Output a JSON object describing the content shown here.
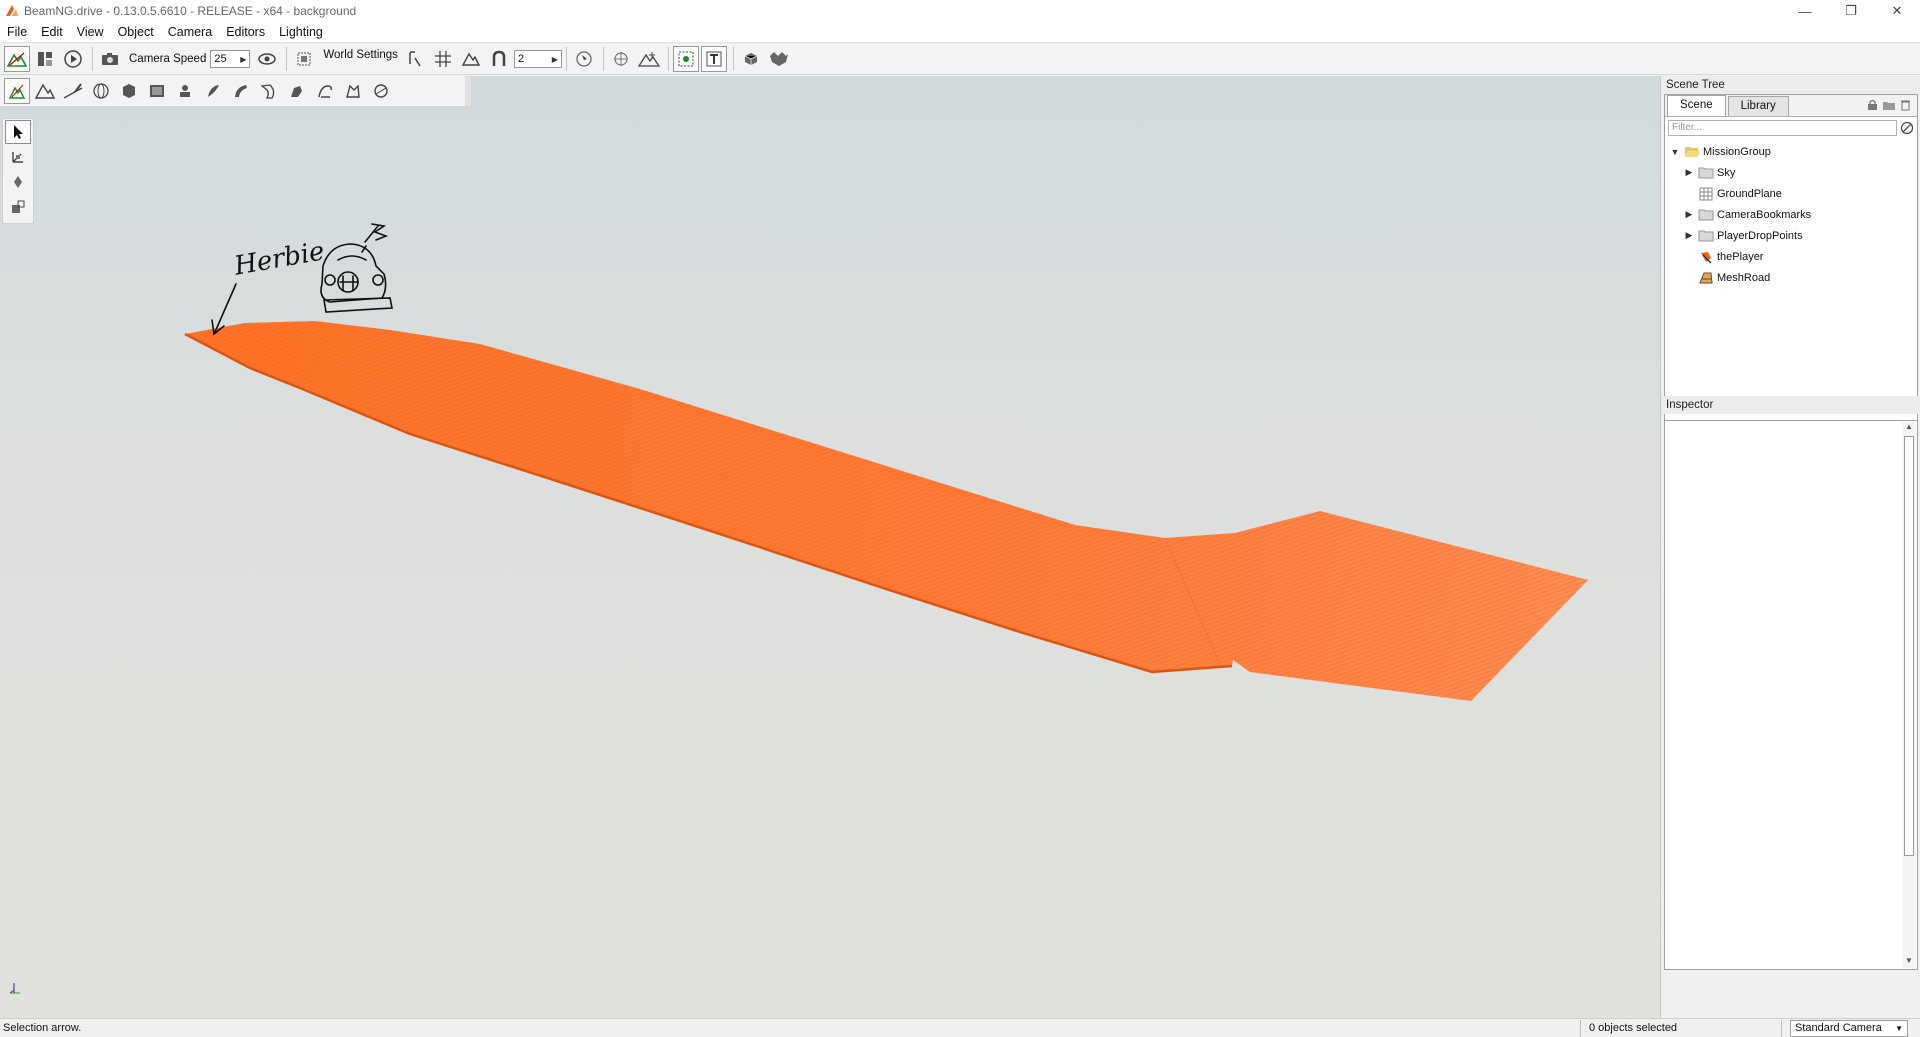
{
  "window": {
    "title": "BeamNG.drive - 0.13.0.5.6610 - RELEASE - x64 - background",
    "minimize": "—",
    "restore": "❐",
    "close": "✕"
  },
  "menu": [
    "File",
    "Edit",
    "View",
    "Object",
    "Camera",
    "Editors",
    "Lighting"
  ],
  "toolbar": {
    "camera_speed_label": "Camera Speed",
    "camera_speed_value": "25",
    "world_settings_label": "World Settings",
    "snap_value": "2"
  },
  "viewport": {
    "annotation_text": "Herbie",
    "road_color": "#ff7a33"
  },
  "scene_tree": {
    "header": "Scene Tree",
    "tabs": [
      "Scene",
      "Library"
    ],
    "filter_placeholder": "Filter...",
    "items": [
      {
        "label": "MissionGroup",
        "icon": "folder-open-icon",
        "indent": 0,
        "expander": "▼"
      },
      {
        "label": "Sky",
        "icon": "folder-icon",
        "indent": 1,
        "expander": "▶"
      },
      {
        "label": "GroundPlane",
        "icon": "grid-icon",
        "indent": 1,
        "expander": ""
      },
      {
        "label": "CameraBookmarks",
        "icon": "folder-icon",
        "indent": 1,
        "expander": "▶"
      },
      {
        "label": "PlayerDropPoints",
        "icon": "folder-icon",
        "indent": 1,
        "expander": "▶"
      },
      {
        "label": "thePlayer",
        "icon": "player-icon",
        "indent": 1,
        "expander": ""
      },
      {
        "label": "MeshRoad",
        "icon": "road-icon",
        "indent": 1,
        "expander": ""
      }
    ]
  },
  "inspector": {
    "header": "Inspector"
  },
  "status": {
    "message": "Selection arrow.",
    "selection_count": "0 objects selected",
    "camera_mode": "Standard Camera"
  }
}
